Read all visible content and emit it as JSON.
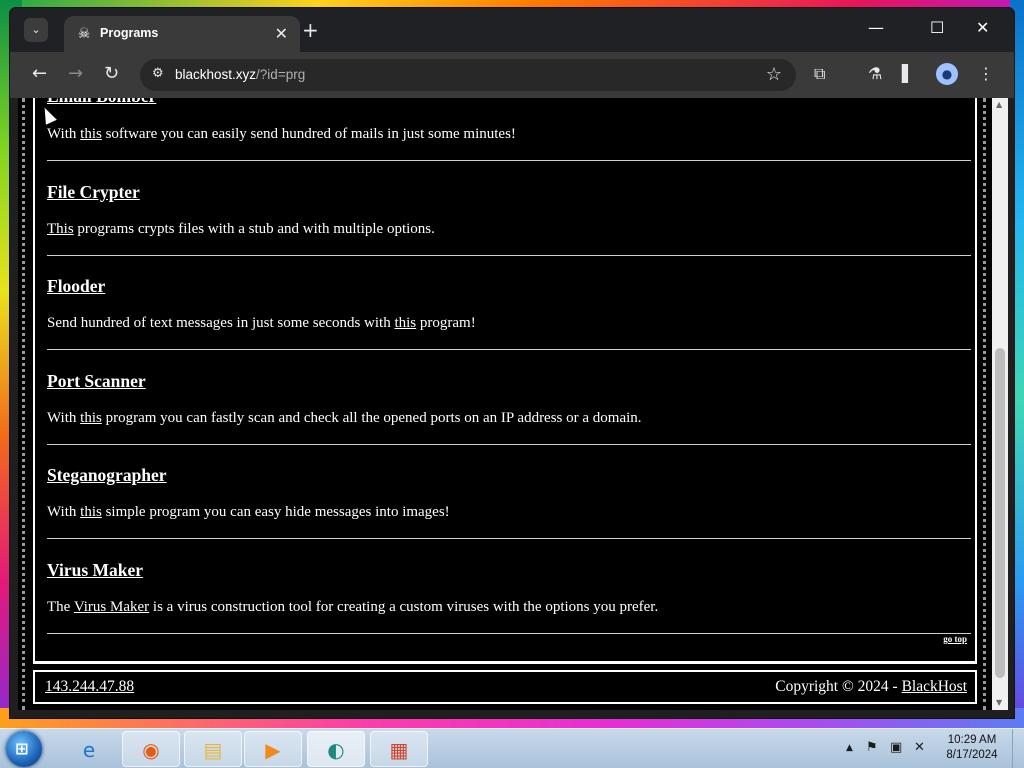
{
  "browser": {
    "tab_title": "Programs",
    "tab_favicon": "pirate-flag-icon",
    "url_host": "blackhost.xyz",
    "url_path": "/?id=prg"
  },
  "programs": [
    {
      "title": "Email Bomber",
      "desc_before": "With ",
      "desc_link": "this",
      "desc_after": " software you can easily send hundred of mails in just some minutes!"
    },
    {
      "title": "File Crypter",
      "desc_before": "",
      "desc_link": "This",
      "desc_after": " programs crypts files with a stub and with multiple options."
    },
    {
      "title": "Flooder",
      "desc_before": "Send hundred of text messages in just some seconds with ",
      "desc_link": "this",
      "desc_after": " program!"
    },
    {
      "title": "Port Scanner",
      "desc_before": "With ",
      "desc_link": "this",
      "desc_after": " program you can fastly scan and check all the opened ports on an IP address or a domain."
    },
    {
      "title": "Steganographer",
      "desc_before": "With ",
      "desc_link": "this",
      "desc_after": " simple program you can easy hide messages into images!"
    },
    {
      "title": "Virus Maker",
      "desc_before": "The ",
      "desc_link": "Virus Maker",
      "desc_after": " is a virus construction tool for creating a custom viruses with the options you prefer."
    }
  ],
  "go_top": "go top",
  "footer": {
    "ip": "143.244.47.88",
    "copyright_prefix": "Copyright © 2024 - ",
    "brand": "BlackHost"
  },
  "taskbar": {
    "time": "10:29 AM",
    "date": "8/17/2024"
  }
}
